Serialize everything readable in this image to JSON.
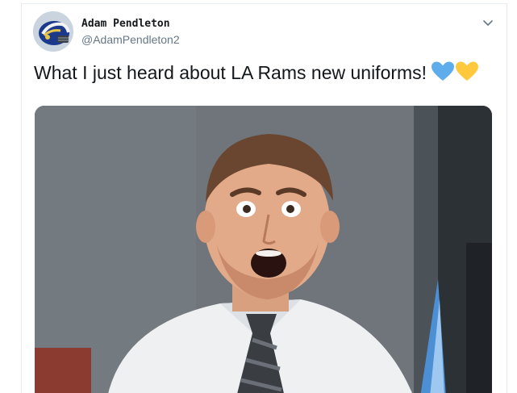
{
  "tweet": {
    "author": {
      "display_name": "Adam Pendleton",
      "handle": "@AdamPendleton2",
      "avatar_icon": "rams-helmet-avatar"
    },
    "text": "What I just heard about LA Rams new uniforms!",
    "emoji": [
      "blue-heart",
      "yellow-heart"
    ],
    "media": {
      "type": "gif",
      "description_icon": "surprised-man-gif"
    }
  },
  "colors": {
    "name": "#14171a",
    "handle": "#657786",
    "border": "#e6ecf0",
    "blue_heart": "#5dadec",
    "yellow_heart": "#ffc83d"
  }
}
